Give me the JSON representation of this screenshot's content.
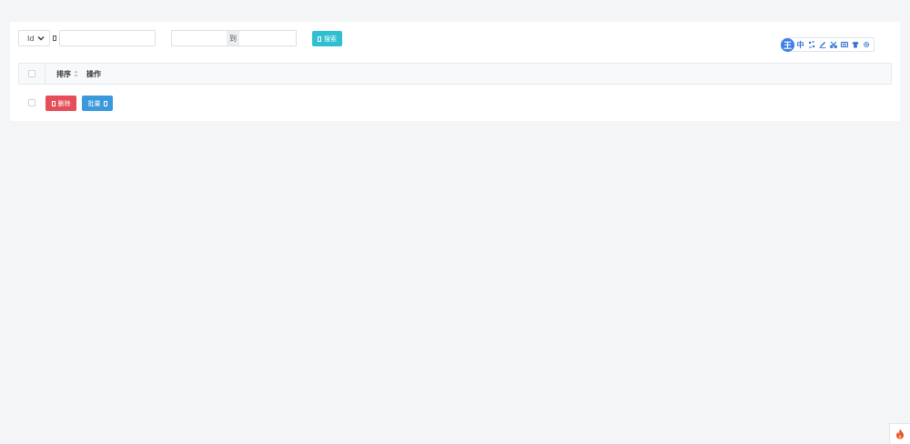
{
  "filter": {
    "field_select": {
      "selected": "Id"
    },
    "keyword_input": {
      "value": "",
      "placeholder": ""
    },
    "range": {
      "from_value": "",
      "separator": "到",
      "to_value": ""
    },
    "search_label": "搜索"
  },
  "table": {
    "columns": [
      {
        "label": "排序",
        "sortable": true
      },
      {
        "label": "操作",
        "sortable": false
      }
    ],
    "rows": []
  },
  "bulk_actions": {
    "delete_label": "删除",
    "batch_label": "批量"
  },
  "toolbar": {
    "logo_glyph": "王",
    "lang_label": "中",
    "icons": [
      "link-icon",
      "pen-icon",
      "scissors-icon",
      "keyboard-icon",
      "shirt-icon",
      "gear-icon"
    ]
  },
  "colors": {
    "search": "#30bfd0",
    "delete": "#e54d58",
    "batch": "#3a98dc",
    "toolbar_accent": "#3c7fe6",
    "flame": "#e8532c"
  }
}
